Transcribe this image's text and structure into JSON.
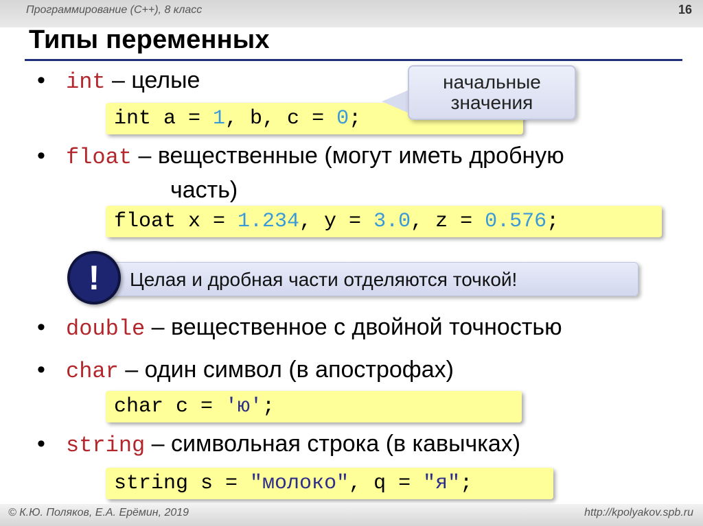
{
  "header": {
    "course": "Программирование (С++), 8 класс",
    "page": "16"
  },
  "title": "Типы переменных",
  "bullets": {
    "b1": {
      "kw": "int",
      "text": " – целые"
    },
    "b2": {
      "kw": "float",
      "text": " – вещественные (могут иметь дробную",
      "cont": "часть)"
    },
    "b3": {
      "kw": "double",
      "text": " – вещественное с двойной точностью"
    },
    "b4": {
      "kw": "char",
      "text": " – один символ (в апострофах)"
    },
    "b5": {
      "kw": "string",
      "text": " – символьная строка (в кавычках)"
    }
  },
  "code": {
    "int": {
      "p1": "int a = ",
      "n1": "1",
      "p2": ", b, c = ",
      "n2": "0",
      "p3": ";"
    },
    "float": {
      "p1": "float x = ",
      "n1": "1.234",
      "p2": ", y = ",
      "n2": "3.0",
      "p3": ", z = ",
      "n3": "0.576",
      "p4": ";"
    },
    "char": {
      "p1": "char c = ",
      "s1": "'ю'",
      "p2": ";"
    },
    "string": {
      "p1": "string s = ",
      "s1": "\"молоко\"",
      "p2": ", q = ",
      "s2": "\"я\"",
      "p3": ";"
    }
  },
  "callout": {
    "line1": "начальные",
    "line2": "значения"
  },
  "note": {
    "icon": "!",
    "text": "Целая и дробная части отделяются точкой!"
  },
  "footer": {
    "left": "© К.Ю. Поляков, Е.А. Ерёмин, 2019",
    "right": "http://kpolyakov.spb.ru"
  }
}
